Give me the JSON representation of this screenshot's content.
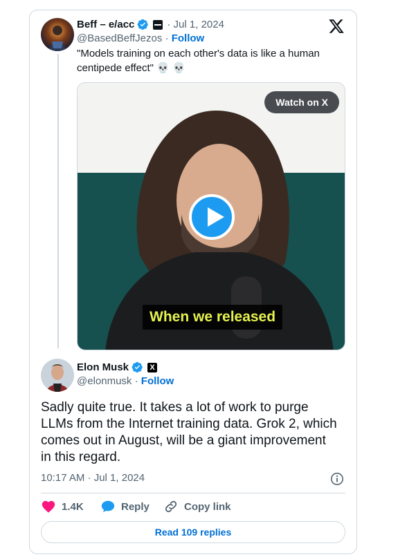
{
  "quoted_tweet": {
    "display_name": "Beff – e/acc",
    "date": "· Jul 1, 2024",
    "handle": "@BasedBeffJezos",
    "separator": " · ",
    "follow_label": "Follow",
    "text": "\"Models training on each other's data is like a human centipede effect\"",
    "emoji": "💀 💀",
    "video": {
      "watch_label": "Watch on X",
      "caption": "When we released"
    }
  },
  "tweet": {
    "display_name": "Elon Musk",
    "x_badge": "X",
    "handle": "@elonmusk",
    "separator": " · ",
    "follow_label": "Follow",
    "text": "Sadly quite true. It takes a lot of work to purge LLMs from the Internet training data. Grok 2, which comes out in August, will be a giant improvement in this regard.",
    "timestamp": "10:17 AM · Jul 1, 2024"
  },
  "actions": {
    "likes": "1.4K",
    "reply_label": "Reply",
    "copy_label": "Copy link",
    "read_replies": "Read 109 replies"
  },
  "colors": {
    "accent_blue": "#1d9bf0",
    "link_blue": "#006fd6",
    "like_pink": "#f91880",
    "muted_text": "#536471",
    "caption_yellow": "#e5f24f"
  },
  "icons": [
    "verified-badge-icon",
    "x-logo-icon",
    "play-icon",
    "heart-icon",
    "reply-bubble-icon",
    "link-icon",
    "info-icon"
  ]
}
